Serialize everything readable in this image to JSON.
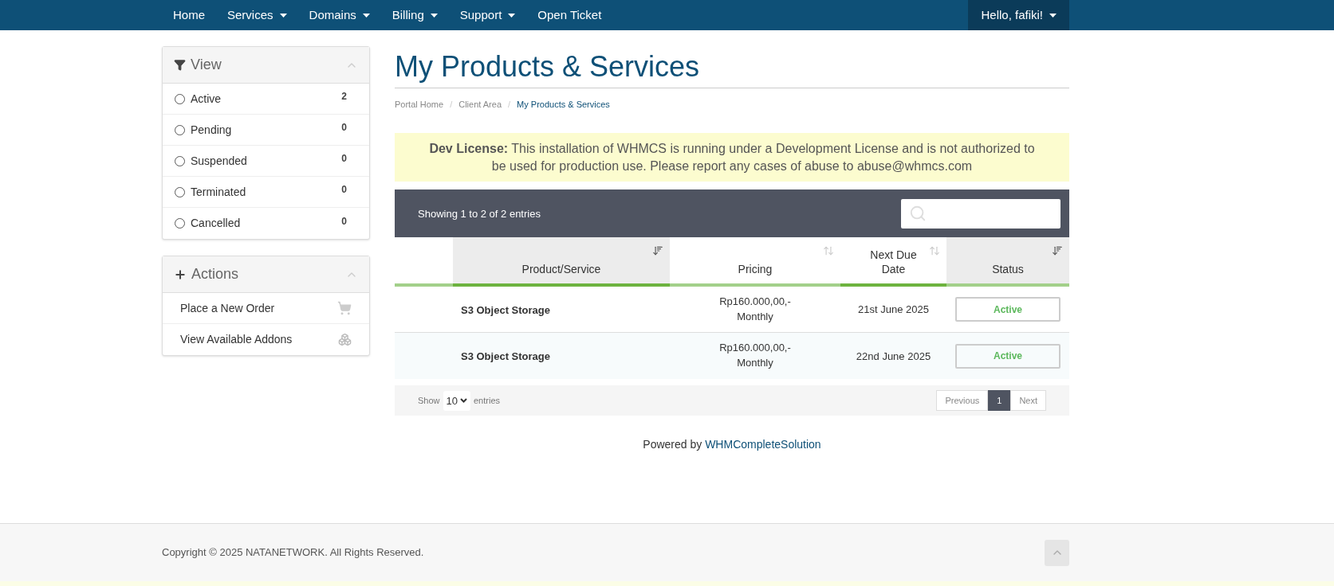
{
  "nav": {
    "items": [
      {
        "label": "Home",
        "dropdown": false
      },
      {
        "label": "Services",
        "dropdown": true
      },
      {
        "label": "Domains",
        "dropdown": true
      },
      {
        "label": "Billing",
        "dropdown": true
      },
      {
        "label": "Support",
        "dropdown": true
      },
      {
        "label": "Open Ticket",
        "dropdown": false
      }
    ],
    "user": "Hello, fafiki!"
  },
  "sidebar": {
    "view": {
      "title": "View",
      "filters": [
        {
          "label": "Active",
          "count": "2",
          "selected": false
        },
        {
          "label": "Pending",
          "count": "0",
          "selected": false
        },
        {
          "label": "Suspended",
          "count": "0",
          "selected": false
        },
        {
          "label": "Terminated",
          "count": "0",
          "selected": false
        },
        {
          "label": "Cancelled",
          "count": "0",
          "selected": false
        }
      ]
    },
    "actions": {
      "title": "Actions",
      "items": [
        {
          "label": "Place a New Order",
          "kind": "order"
        },
        {
          "label": "View Available Addons",
          "kind": "addons"
        }
      ]
    }
  },
  "page": {
    "title": "My Products & Services",
    "breadcrumb": [
      {
        "label": "Portal Home",
        "selected": false
      },
      {
        "separator": "/",
        "label": "Client Area",
        "selected": false
      },
      {
        "separator": "/",
        "label": "My Products & Services",
        "selected": true
      }
    ],
    "notice": "**Dev License:** This installation of WHMCS is running under a Development License and is not authorized to be used for production use. Please report any cases of abuse to abuse@whmcs.com"
  },
  "table": {
    "info": "Showing 1 to 2 of 2 entries",
    "columns": [
      {
        "label": "Product/Service",
        "sorted": true,
        "shaded": true,
        "strong_underline": true
      },
      {
        "label": "Pricing",
        "sorted": false,
        "shaded": false,
        "strong_underline": false
      },
      {
        "label": "Next Due Date",
        "sorted": false,
        "shaded": false,
        "strong_underline": true
      },
      {
        "label": "Status",
        "sorted": true,
        "shaded": true,
        "strong_underline": false
      }
    ],
    "rows": [
      {
        "product": "S3 Object Storage",
        "price": "Rp160.000,00,-",
        "cycle": "Monthly",
        "due": "21st June 2025",
        "status": "Active"
      },
      {
        "product": "S3 Object Storage",
        "price": "Rp160.000,00,-",
        "cycle": "Monthly",
        "due": "22nd June 2025",
        "status": "Active"
      }
    ],
    "length": {
      "before": "Show",
      "value": "10",
      "after": "entries"
    },
    "pagination": [
      {
        "label": "Previous",
        "selected": false
      },
      {
        "label": "1",
        "selected": true
      },
      {
        "label": "Next",
        "selected": false
      }
    ]
  },
  "powered": {
    "text": "Powered by",
    "link": "WHMCompleteSolution"
  },
  "footer": {
    "copyright": "Copyright © 2025 NATANETWORK. All Rights Reserved."
  }
}
